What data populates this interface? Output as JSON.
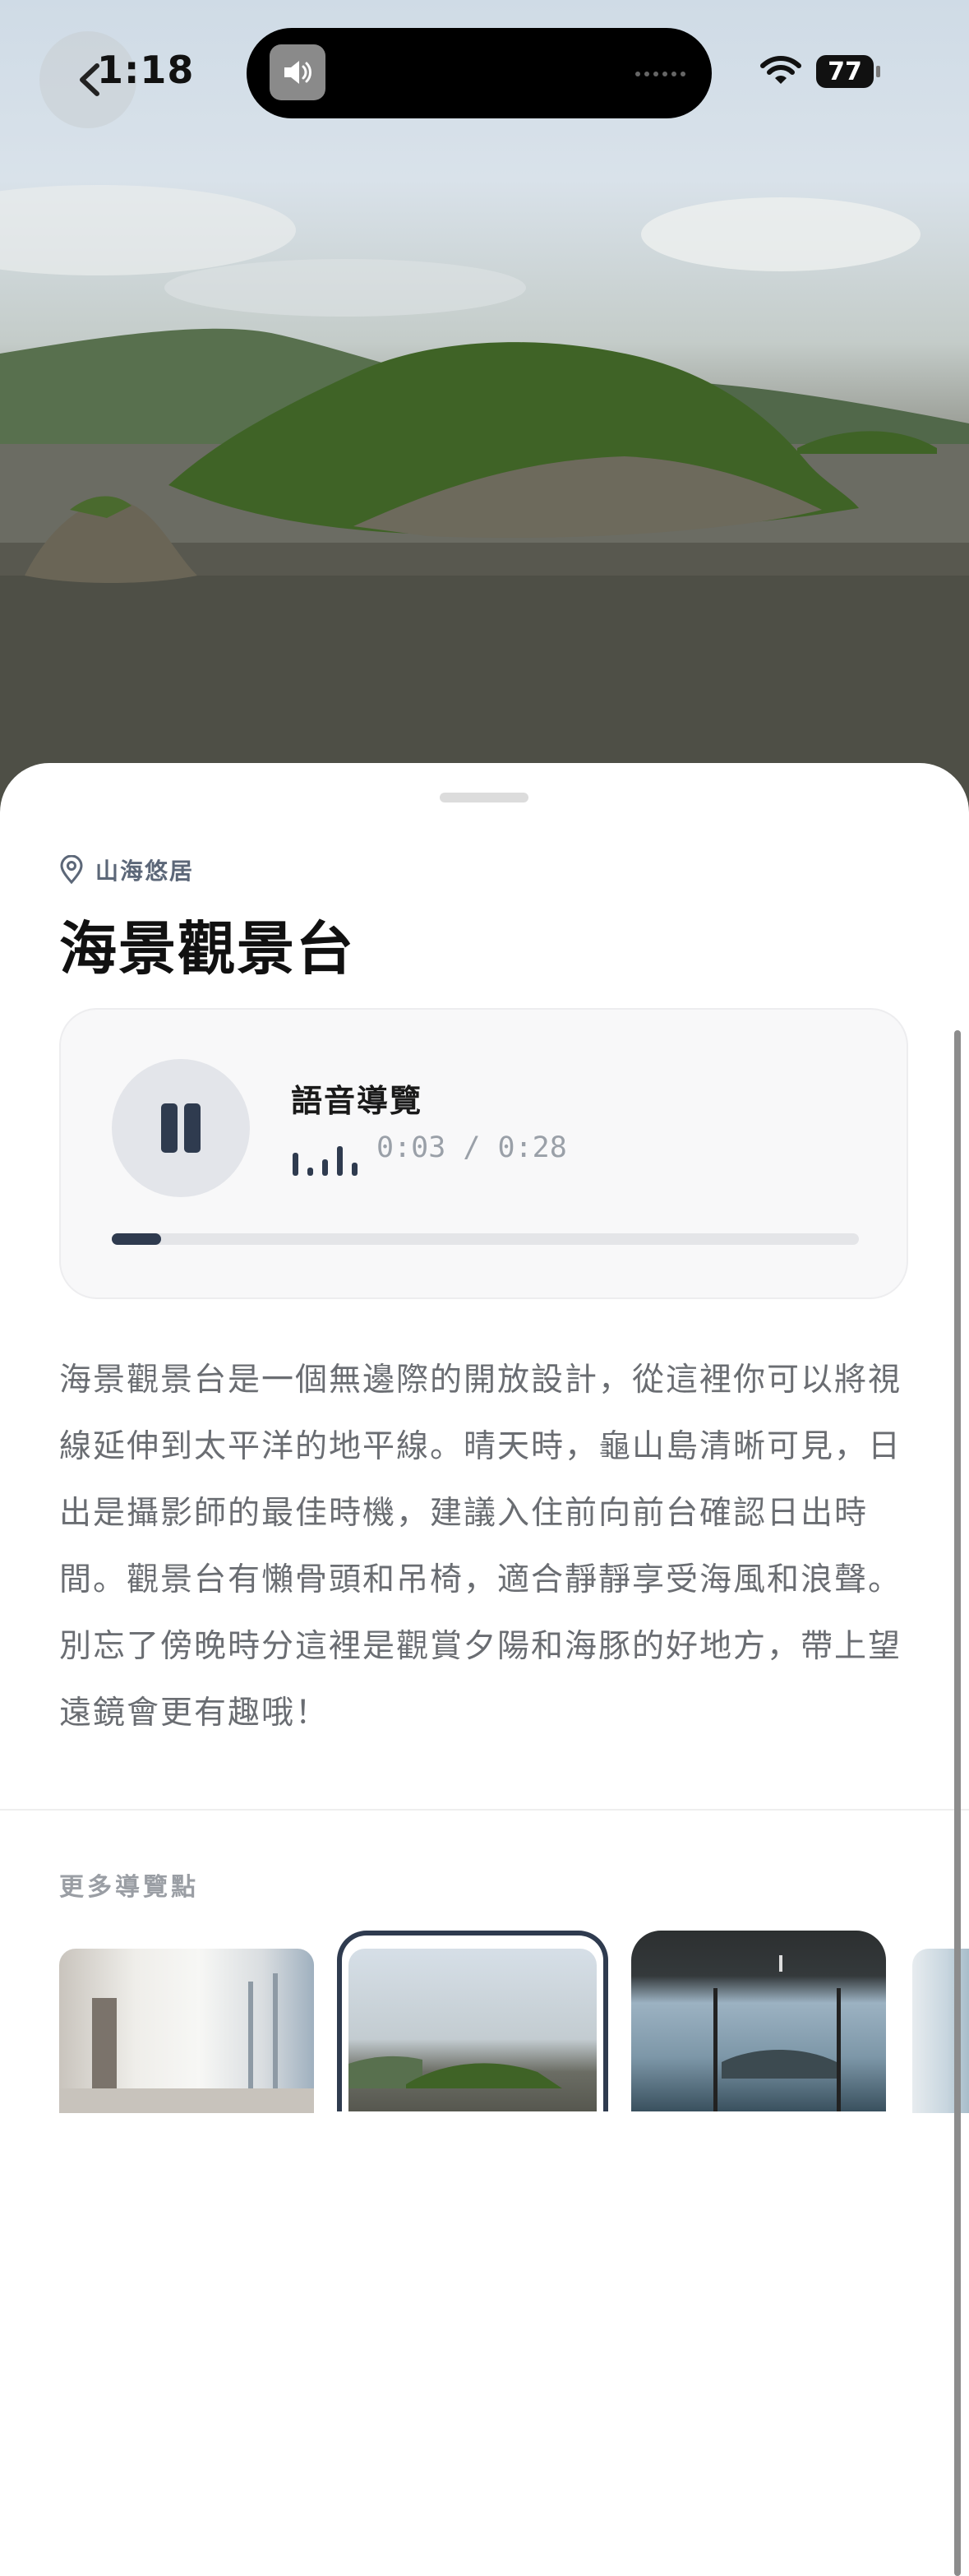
{
  "status": {
    "time": "1:18",
    "battery": "77"
  },
  "location": {
    "name": "山海悠居"
  },
  "spot": {
    "title": "海景觀景台"
  },
  "audio": {
    "title": "語音導覽",
    "time": "0:03 / 0:28",
    "progress": 0.066
  },
  "description": "海景觀景台是一個無邊際的開放設計，從這裡你可以將視線延伸到太平洋的地平線。晴天時，龜山島清晰可見，日出是攝影師的最佳時機，建議入住前向前台確認日出時間。觀景台有懶骨頭和吊椅，適合靜靜享受海風和浪聲。別忘了傍晚時分這裡是觀賞夕陽和海豚的好地方，帶上望遠鏡會更有趣哦！",
  "more": {
    "title": "更多導覽點"
  },
  "icons": {
    "back": "chevron-left-icon",
    "speaker": "speaker-icon",
    "wifi": "wifi-icon",
    "location": "location-pin-icon",
    "pause": "pause-icon",
    "waveform": "waveform-icon"
  },
  "colors": {
    "accent": "#2f3b4f",
    "muted": "#6a6d72",
    "progress_track": "#e4e5e8"
  }
}
